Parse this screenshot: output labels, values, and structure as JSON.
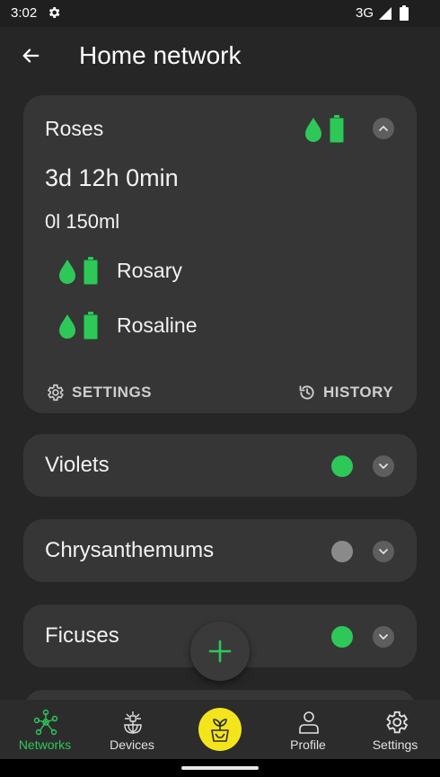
{
  "status_bar": {
    "time": "3:02",
    "network_type": "3G",
    "icons": [
      "settings-gear-icon",
      "signal-icon",
      "battery-icon"
    ]
  },
  "app_bar": {
    "title": "Home network",
    "back_icon": "arrow-left-icon"
  },
  "colors": {
    "accent_green": "#2ec859",
    "offline_gray": "#8a8a8a",
    "fab_accent_yellow": "#f4e41c",
    "card_bg": "#363636",
    "screen_bg": "#262626"
  },
  "expanded_network": {
    "name": "Roses",
    "duration": "3d 12h 0min",
    "volume": "0l 150ml",
    "status_icons": [
      "water-drop-icon",
      "battery-icon"
    ],
    "devices": [
      {
        "name": "Rosary",
        "icons": [
          "water-drop-icon",
          "battery-icon"
        ]
      },
      {
        "name": "Rosaline",
        "icons": [
          "water-drop-icon",
          "battery-icon"
        ]
      }
    ],
    "settings_label": "SETTINGS",
    "history_label": "HISTORY"
  },
  "networks": [
    {
      "name": "Violets",
      "status": "online",
      "status_color": "#2ec859"
    },
    {
      "name": "Chrysanthemums",
      "status": "offline",
      "status_color": "#8a8a8a"
    },
    {
      "name": "Ficuses",
      "status": "online",
      "status_color": "#2ec859"
    }
  ],
  "fab": {
    "icon": "plus-icon"
  },
  "bottom_nav": {
    "items": [
      {
        "label": "Networks",
        "icon": "network-icon",
        "active": true
      },
      {
        "label": "Devices",
        "icon": "sprinkler-icon",
        "active": false
      },
      {
        "label": "",
        "icon": "plant-pot-icon",
        "active": false
      },
      {
        "label": "Profile",
        "icon": "person-icon",
        "active": false
      },
      {
        "label": "Settings",
        "icon": "gear-icon",
        "active": false
      }
    ]
  }
}
